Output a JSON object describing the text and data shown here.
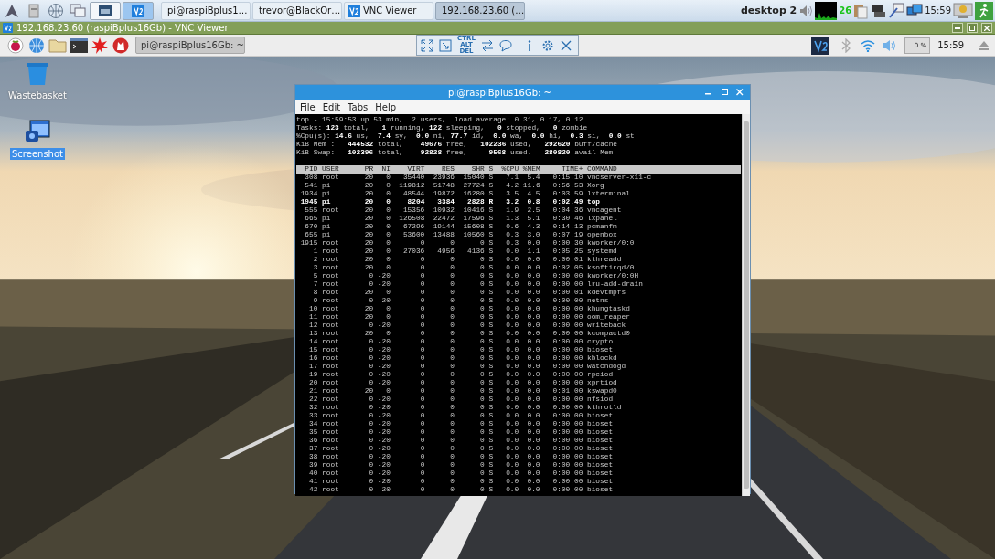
{
  "host_taskbar": {
    "workspaces": [
      {
        "kind": "window",
        "selected": false
      },
      {
        "kind": "vnc",
        "selected": true
      }
    ],
    "tasks": [
      {
        "label": "pi@raspiBplus1…",
        "kind": "network",
        "selected": false
      },
      {
        "label": "trevor@BlackOr…",
        "kind": "monitor",
        "selected": false
      },
      {
        "label": "VNC Viewer",
        "kind": "vnc",
        "selected": false
      },
      {
        "label": "192.168.23.60 (…",
        "kind": "vnc",
        "selected": true
      }
    ],
    "desktop_name": "desktop 2",
    "cpu_reading": "26",
    "clock": "15:59"
  },
  "vnc_window": {
    "title": "192.168.23.60 (raspiBplus16Gb) - VNC Viewer"
  },
  "vnc_toolbar": {
    "ctrl_alt_del": "CTRL ALT DEL"
  },
  "remote_panel": {
    "tasks": [
      {
        "label": "pi@raspiBplus16Gb: ~",
        "selected": true
      }
    ],
    "cpu_reading": "0 %",
    "clock": "15:59"
  },
  "desktop_icons": [
    {
      "label": "Wastebasket",
      "kind": "trash",
      "selected": false
    },
    {
      "label": "Screenshot",
      "kind": "screenshot",
      "selected": true
    }
  ],
  "terminal": {
    "title": "pi@raspiBplus16Gb: ~",
    "menu": [
      "File",
      "Edit",
      "Tabs",
      "Help"
    ],
    "summary": [
      "top - 15:59:53 up 53 min,  2 users,  load average: 0.31, 0.17, 0.12",
      "Tasks: **123** total,   **1** running, **122** sleeping,   **0** stopped,   **0** zombie",
      "%Cpu(s): **14.6** us,  **7.4** sy,  **0.0** ni, **77.7** id,  **0.0** wa,  **0.0** hi,  **0.3** si,  **0.0** st",
      "KiB Mem :   **444532** total,    **49676** free,   **102236** used,   **292620** buff/cache",
      "KiB Swap:   **102396** total,    **92828** free,     **9568** used.   **280820** avail Mem"
    ],
    "process_table": {
      "columns": [
        "PID",
        "USER",
        "PR",
        "NI",
        "VIRT",
        "RES",
        "SHR",
        "S",
        "%CPU",
        "%MEM",
        "TIME+",
        "COMMAND"
      ],
      "rows": [
        {
          "cells": [
            "308",
            "root",
            "20",
            "0",
            "35440",
            "23936",
            "15040",
            "S",
            "7.1",
            "5.4",
            "0:15.10",
            "vncserver-x11-c"
          ],
          "bold": false
        },
        {
          "cells": [
            "541",
            "pi",
            "20",
            "0",
            "119812",
            "51748",
            "27724",
            "S",
            "4.2",
            "11.6",
            "0:56.53",
            "Xorg"
          ],
          "bold": false
        },
        {
          "cells": [
            "1934",
            "pi",
            "20",
            "0",
            "48544",
            "19872",
            "16280",
            "S",
            "3.5",
            "4.5",
            "0:03.59",
            "lxterminal"
          ],
          "bold": false
        },
        {
          "cells": [
            "1945",
            "pi",
            "20",
            "0",
            "8204",
            "3384",
            "2828",
            "R",
            "3.2",
            "0.8",
            "0:02.49",
            "top"
          ],
          "bold": true
        },
        {
          "cells": [
            "555",
            "root",
            "20",
            "0",
            "15356",
            "10932",
            "10416",
            "S",
            "1.9",
            "2.5",
            "0:04.36",
            "vncagent"
          ],
          "bold": false
        },
        {
          "cells": [
            "665",
            "pi",
            "20",
            "0",
            "126508",
            "22472",
            "17596",
            "S",
            "1.3",
            "5.1",
            "0:30.46",
            "lxpanel"
          ],
          "bold": false
        },
        {
          "cells": [
            "670",
            "pi",
            "20",
            "0",
            "67296",
            "19144",
            "15608",
            "S",
            "0.6",
            "4.3",
            "0:14.13",
            "pcmanfm"
          ],
          "bold": false
        },
        {
          "cells": [
            "655",
            "pi",
            "20",
            "0",
            "53600",
            "13488",
            "10560",
            "S",
            "0.3",
            "3.0",
            "0:07.19",
            "openbox"
          ],
          "bold": false
        },
        {
          "cells": [
            "1915",
            "root",
            "20",
            "0",
            "0",
            "0",
            "0",
            "S",
            "0.3",
            "0.0",
            "0:00.30",
            "kworker/0:0"
          ],
          "bold": false
        },
        {
          "cells": [
            "1",
            "root",
            "20",
            "0",
            "27036",
            "4956",
            "4136",
            "S",
            "0.0",
            "1.1",
            "0:05.25",
            "systemd"
          ],
          "bold": false
        },
        {
          "cells": [
            "2",
            "root",
            "20",
            "0",
            "0",
            "0",
            "0",
            "S",
            "0.0",
            "0.0",
            "0:00.01",
            "kthreadd"
          ],
          "bold": false
        },
        {
          "cells": [
            "3",
            "root",
            "20",
            "0",
            "0",
            "0",
            "0",
            "S",
            "0.0",
            "0.0",
            "0:02.05",
            "ksoftirqd/0"
          ],
          "bold": false
        },
        {
          "cells": [
            "5",
            "root",
            "0",
            "-20",
            "0",
            "0",
            "0",
            "S",
            "0.0",
            "0.0",
            "0:00.00",
            "kworker/0:0H"
          ],
          "bold": false
        },
        {
          "cells": [
            "7",
            "root",
            "0",
            "-20",
            "0",
            "0",
            "0",
            "S",
            "0.0",
            "0.0",
            "0:00.00",
            "lru-add-drain"
          ],
          "bold": false
        },
        {
          "cells": [
            "8",
            "root",
            "20",
            "0",
            "0",
            "0",
            "0",
            "S",
            "0.0",
            "0.0",
            "0:00.01",
            "kdevtmpfs"
          ],
          "bold": false
        },
        {
          "cells": [
            "9",
            "root",
            "0",
            "-20",
            "0",
            "0",
            "0",
            "S",
            "0.0",
            "0.0",
            "0:00.00",
            "netns"
          ],
          "bold": false
        },
        {
          "cells": [
            "10",
            "root",
            "20",
            "0",
            "0",
            "0",
            "0",
            "S",
            "0.0",
            "0.0",
            "0:00.00",
            "khungtaskd"
          ],
          "bold": false
        },
        {
          "cells": [
            "11",
            "root",
            "20",
            "0",
            "0",
            "0",
            "0",
            "S",
            "0.0",
            "0.0",
            "0:00.00",
            "oom_reaper"
          ],
          "bold": false
        },
        {
          "cells": [
            "12",
            "root",
            "0",
            "-20",
            "0",
            "0",
            "0",
            "S",
            "0.0",
            "0.0",
            "0:00.00",
            "writeback"
          ],
          "bold": false
        },
        {
          "cells": [
            "13",
            "root",
            "20",
            "0",
            "0",
            "0",
            "0",
            "S",
            "0.0",
            "0.0",
            "0:00.00",
            "kcompactd0"
          ],
          "bold": false
        },
        {
          "cells": [
            "14",
            "root",
            "0",
            "-20",
            "0",
            "0",
            "0",
            "S",
            "0.0",
            "0.0",
            "0:00.00",
            "crypto"
          ],
          "bold": false
        },
        {
          "cells": [
            "15",
            "root",
            "0",
            "-20",
            "0",
            "0",
            "0",
            "S",
            "0.0",
            "0.0",
            "0:00.00",
            "bioset"
          ],
          "bold": false
        },
        {
          "cells": [
            "16",
            "root",
            "0",
            "-20",
            "0",
            "0",
            "0",
            "S",
            "0.0",
            "0.0",
            "0:00.00",
            "kblockd"
          ],
          "bold": false
        },
        {
          "cells": [
            "17",
            "root",
            "0",
            "-20",
            "0",
            "0",
            "0",
            "S",
            "0.0",
            "0.0",
            "0:00.00",
            "watchdogd"
          ],
          "bold": false
        },
        {
          "cells": [
            "19",
            "root",
            "0",
            "-20",
            "0",
            "0",
            "0",
            "S",
            "0.0",
            "0.0",
            "0:00.00",
            "rpciod"
          ],
          "bold": false
        },
        {
          "cells": [
            "20",
            "root",
            "0",
            "-20",
            "0",
            "0",
            "0",
            "S",
            "0.0",
            "0.0",
            "0:00.00",
            "xprtiod"
          ],
          "bold": false
        },
        {
          "cells": [
            "21",
            "root",
            "20",
            "0",
            "0",
            "0",
            "0",
            "S",
            "0.0",
            "0.0",
            "0:01.00",
            "kswapd0"
          ],
          "bold": false
        },
        {
          "cells": [
            "22",
            "root",
            "0",
            "-20",
            "0",
            "0",
            "0",
            "S",
            "0.0",
            "0.0",
            "0:00.00",
            "nfsiod"
          ],
          "bold": false
        },
        {
          "cells": [
            "32",
            "root",
            "0",
            "-20",
            "0",
            "0",
            "0",
            "S",
            "0.0",
            "0.0",
            "0:00.00",
            "kthrotld"
          ],
          "bold": false
        },
        {
          "cells": [
            "33",
            "root",
            "0",
            "-20",
            "0",
            "0",
            "0",
            "S",
            "0.0",
            "0.0",
            "0:00.00",
            "bioset"
          ],
          "bold": false
        },
        {
          "cells": [
            "34",
            "root",
            "0",
            "-20",
            "0",
            "0",
            "0",
            "S",
            "0.0",
            "0.0",
            "0:00.00",
            "bioset"
          ],
          "bold": false
        },
        {
          "cells": [
            "35",
            "root",
            "0",
            "-20",
            "0",
            "0",
            "0",
            "S",
            "0.0",
            "0.0",
            "0:00.00",
            "bioset"
          ],
          "bold": false
        },
        {
          "cells": [
            "36",
            "root",
            "0",
            "-20",
            "0",
            "0",
            "0",
            "S",
            "0.0",
            "0.0",
            "0:00.00",
            "bioset"
          ],
          "bold": false
        },
        {
          "cells": [
            "37",
            "root",
            "0",
            "-20",
            "0",
            "0",
            "0",
            "S",
            "0.0",
            "0.0",
            "0:00.00",
            "bioset"
          ],
          "bold": false
        },
        {
          "cells": [
            "38",
            "root",
            "0",
            "-20",
            "0",
            "0",
            "0",
            "S",
            "0.0",
            "0.0",
            "0:00.00",
            "bioset"
          ],
          "bold": false
        },
        {
          "cells": [
            "39",
            "root",
            "0",
            "-20",
            "0",
            "0",
            "0",
            "S",
            "0.0",
            "0.0",
            "0:00.00",
            "bioset"
          ],
          "bold": false
        },
        {
          "cells": [
            "40",
            "root",
            "0",
            "-20",
            "0",
            "0",
            "0",
            "S",
            "0.0",
            "0.0",
            "0:00.00",
            "bioset"
          ],
          "bold": false
        },
        {
          "cells": [
            "41",
            "root",
            "0",
            "-20",
            "0",
            "0",
            "0",
            "S",
            "0.0",
            "0.0",
            "0:00.00",
            "bioset"
          ],
          "bold": false
        },
        {
          "cells": [
            "42",
            "root",
            "0",
            "-20",
            "0",
            "0",
            "0",
            "S",
            "0.0",
            "0.0",
            "0:00.00",
            "bioset"
          ],
          "bold": false
        }
      ]
    }
  }
}
